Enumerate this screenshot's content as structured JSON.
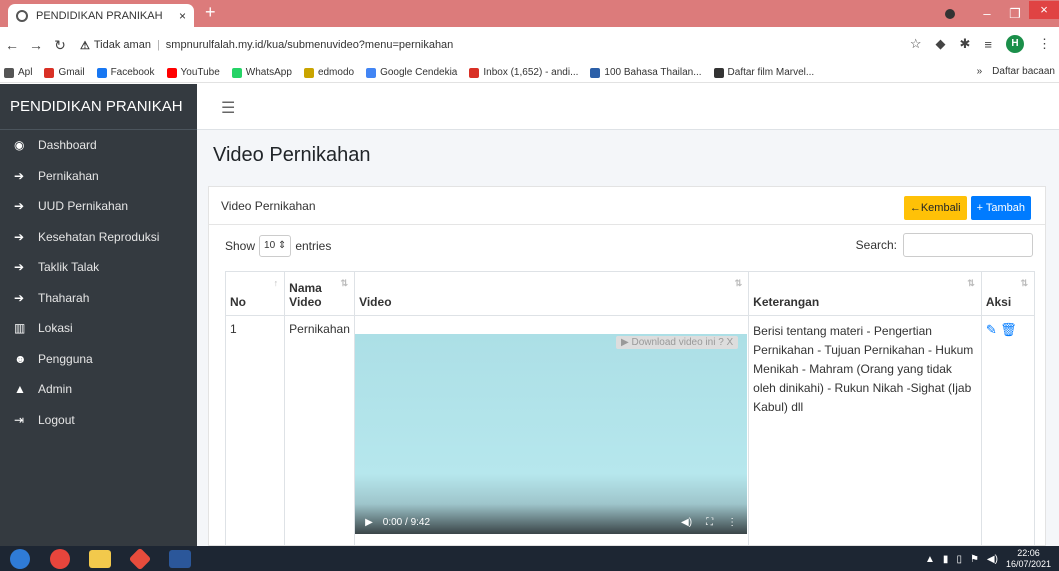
{
  "browser": {
    "tab_title": "PENDIDIKAN PRANIKAH",
    "tab_close": "×",
    "new_tab": "+",
    "security_label": "Tidak aman",
    "url": "smpnurulfalah.my.id/kua/submenuvideo?menu=pernikahan",
    "profile_initial": "H",
    "bookmarks": [
      {
        "label": "Apl",
        "color": "#555555"
      },
      {
        "label": "Gmail",
        "color": "#d93025"
      },
      {
        "label": "Facebook",
        "color": "#1877f2"
      },
      {
        "label": "YouTube",
        "color": "#ff0000"
      },
      {
        "label": "WhatsApp",
        "color": "#25d366"
      },
      {
        "label": "edmodo",
        "color": "#c9a400"
      },
      {
        "label": "Google Cendekia",
        "color": "#4285f4"
      },
      {
        "label": "Inbox (1,652) - andi...",
        "color": "#d93025"
      },
      {
        "label": "100 Bahasa Thailan...",
        "color": "#2b5fa8"
      },
      {
        "label": "Daftar film Marvel...",
        "color": "#333333"
      }
    ],
    "bookmarks_more": "»",
    "reading_list": "Daftar bacaan"
  },
  "sidebar": {
    "brand": "PENDIDIKAN PRANIKAH",
    "items": [
      {
        "label": "Dashboard",
        "icon": "dashboard-icon",
        "glyph": "◉"
      },
      {
        "label": "Pernikahan",
        "icon": "arrow-right-icon",
        "glyph": "➔"
      },
      {
        "label": "UUD Pernikahan",
        "icon": "arrow-right-icon",
        "glyph": "➔"
      },
      {
        "label": "Kesehatan Reproduksi",
        "icon": "arrow-right-icon",
        "glyph": "➔"
      },
      {
        "label": "Taklik Talak",
        "icon": "arrow-right-icon",
        "glyph": "➔"
      },
      {
        "label": "Thaharah",
        "icon": "arrow-right-icon",
        "glyph": "➔"
      },
      {
        "label": "Lokasi",
        "icon": "map-icon",
        "glyph": "▥"
      },
      {
        "label": "Pengguna",
        "icon": "users-icon",
        "glyph": "☻"
      },
      {
        "label": "Admin",
        "icon": "admin-icon",
        "glyph": "▲"
      },
      {
        "label": "Logout",
        "icon": "logout-icon",
        "glyph": "⇥"
      }
    ]
  },
  "page": {
    "title": "Video Pernikahan",
    "card_title": "Video Pernikahan",
    "back_label": "←Kembali",
    "add_label": "+ Tambah",
    "show_label": "Show",
    "entries_value": "10",
    "entries_label": "entries",
    "search_label": "Search:"
  },
  "table": {
    "headers": [
      "No",
      "Nama Video",
      "Video",
      "Keterangan",
      "Aksi"
    ],
    "rows": [
      {
        "no": "1",
        "nama": "Pernikahan",
        "download_chip": "▶ Download video ini   ? X",
        "video_time": "0:00 / 9:42",
        "keterangan": "Berisi tentang materi - Pengertian Pernikahan - Tujuan Pernikahan - Hukum Menikah - Mahram (Orang yang tidak oleh dinikahi) - Rukun Nikah -Sighat (Ijab Kabul) dll"
      }
    ]
  },
  "taskbar": {
    "time": "22:06",
    "date": "16/07/2021"
  }
}
